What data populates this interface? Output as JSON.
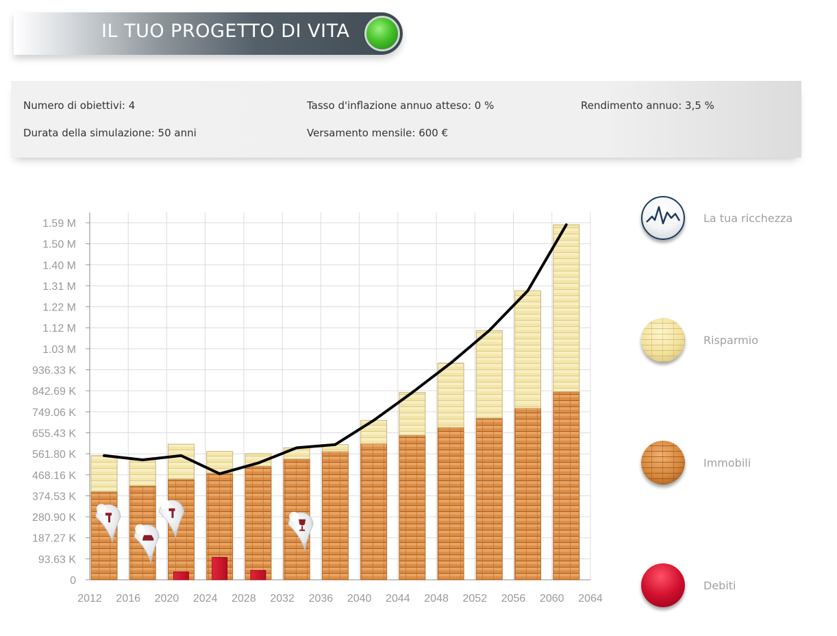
{
  "header": {
    "title": "IL TUO PROGETTO DI VITA",
    "status_color": "#3fbf2a"
  },
  "summary": {
    "goals": "Numero di obiettivi: 4",
    "duration": "Durata della simulazione: 50 anni",
    "inflation": "Tasso d'inflazione annuo atteso: 0 %",
    "monthly": "Versamento mensile: 600 €",
    "return": "Rendimento annuo: 3,5 %"
  },
  "legend": {
    "wealth": "La tua ricchezza",
    "savings": "Risparmio",
    "property": "Immobili",
    "debt": "Debiti"
  },
  "chart_data": {
    "type": "bar",
    "stacked": true,
    "x_ticks": [
      "2012",
      "2016",
      "2020",
      "2024",
      "2028",
      "2032",
      "2036",
      "2040",
      "2044",
      "2048",
      "2052",
      "2056",
      "2060",
      "2064"
    ],
    "y_ticks": [
      "0",
      "93.63 K",
      "187.27 K",
      "280.90 K",
      "374.53 K",
      "468.16 K",
      "561.80 K",
      "655.43 K",
      "749.06 K",
      "842.69 K",
      "936.33 K",
      "1.03 M",
      "1.12 M",
      "1.22 M",
      "1.31 M",
      "1.40 M",
      "1.50 M",
      "1.59 M"
    ],
    "ylim": [
      0,
      1590000
    ],
    "grid": true,
    "legend_position": "right",
    "categories": [
      "2012",
      "2016",
      "2020",
      "2024",
      "2028",
      "2032",
      "2036",
      "2040",
      "2044",
      "2048",
      "2052",
      "2056",
      "2060"
    ],
    "series": [
      {
        "name": "Immobili",
        "color": "#d98c45",
        "values": [
          393000,
          419000,
          449000,
          475000,
          506000,
          538000,
          571000,
          606000,
          644000,
          679000,
          720000,
          764000,
          838000
        ]
      },
      {
        "name": "Risparmio",
        "color": "#f2e3a0",
        "values": [
          160000,
          115000,
          155000,
          97000,
          56000,
          50000,
          31000,
          104000,
          190000,
          286000,
          390000,
          523000,
          743000
        ]
      },
      {
        "name": "Debiti",
        "color": "#cc1128",
        "values": [
          0,
          0,
          35000,
          100000,
          42000,
          0,
          0,
          0,
          0,
          0,
          0,
          0,
          0
        ]
      },
      {
        "name": "La tua ricchezza",
        "color": "#000000",
        "values": [
          553000,
          534000,
          553000,
          472000,
          520000,
          588000,
          602000,
          710000,
          834000,
          965000,
          1110000,
          1287000,
          1581000
        ]
      }
    ],
    "goal_markers": [
      {
        "category": "2012",
        "icon": "hammer-icon",
        "value": 280000
      },
      {
        "category": "2016",
        "icon": "car-icon",
        "value": 190000
      },
      {
        "category": "2020",
        "icon": "hammer-icon",
        "value": 300000
      },
      {
        "category": "2032",
        "icon": "wine-glass-icon",
        "value": 245000
      }
    ]
  }
}
